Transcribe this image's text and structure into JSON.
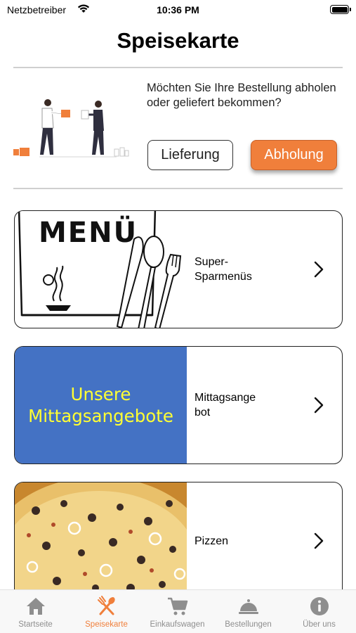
{
  "status_bar": {
    "carrier": "Netzbetreiber",
    "time": "10:36 PM",
    "wifi_icon": "wifi-icon",
    "battery_icon": "battery-icon"
  },
  "header": {
    "title": "Speisekarte"
  },
  "delivery": {
    "question": "Möchten Sie Ihre Bestellung abholen oder geliefert bekommen?",
    "delivery_label": "Lieferung",
    "pickup_label": "Abholung",
    "pickup_color": "#f07f3b"
  },
  "menu_cards": [
    {
      "label_line1": "Super-",
      "label_line2": "Sparmenüs",
      "image_text": "MENÜ"
    },
    {
      "label_line1": "Mittagsange",
      "label_line2": "bot",
      "image_line1": "Unsere",
      "image_line2": "Mittagsangebote",
      "image_bg": "#4472c4",
      "image_text_color": "#ffff33"
    },
    {
      "label_line1": "Pizzen",
      "label_line2": ""
    }
  ],
  "tabbar": {
    "tabs": [
      {
        "label": "Startseite",
        "icon": "home-icon",
        "active": false
      },
      {
        "label": "Speisekarte",
        "icon": "fork-spoon-icon",
        "active": true
      },
      {
        "label": "Einkaufswagen",
        "icon": "cart-icon",
        "active": false
      },
      {
        "label": "Bestellungen",
        "icon": "cloche-icon",
        "active": false
      },
      {
        "label": "Über uns",
        "icon": "info-icon",
        "active": false
      }
    ],
    "active_color": "#f07f3b",
    "inactive_color": "#8e8e8e"
  }
}
